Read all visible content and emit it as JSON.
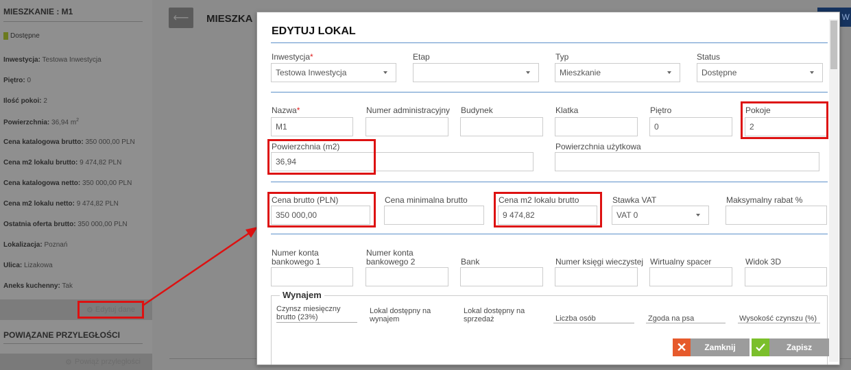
{
  "sidebar": {
    "title": "MIESZKANIE : M1",
    "status": "Dostępne",
    "rows": [
      {
        "label": "Inwestycja:",
        "value": "Testowa Inwestycja"
      },
      {
        "label": "Piętro:",
        "value": "0"
      },
      {
        "label": "Ilość pokoi:",
        "value": "2"
      },
      {
        "label": "Powierzchnia:",
        "value": "36,94 m",
        "sup": "2"
      },
      {
        "label": "Cena katalogowa brutto:",
        "value": "350 000,00 PLN"
      },
      {
        "label": "Cena m2 lokalu brutto:",
        "value": "9 474,82 PLN"
      },
      {
        "label": "Cena katalogowa netto:",
        "value": "350 000,00 PLN"
      },
      {
        "label": "Cena m2 lokalu netto:",
        "value": "9 474,82 PLN"
      },
      {
        "label": "Ostatnia oferta brutto:",
        "value": "350 000,00 PLN"
      },
      {
        "label": "Lokalizacja:",
        "value": "Poznań"
      },
      {
        "label": "Ulica:",
        "value": "Lizakowa"
      },
      {
        "label": "Aneks kuchenny:",
        "value": "Tak"
      }
    ],
    "edit_button": "Edytuj dane",
    "related_title": "POWIĄZANE PRZYLEGŁOŚCI",
    "related_button": "Powiąż przyległości"
  },
  "main": {
    "title": "MIESZKA",
    "top_button": "W"
  },
  "modal": {
    "title": "EDYTUJ LOKAL",
    "inwestycja": {
      "label": "Inwestycja",
      "value": "Testowa Inwestycja"
    },
    "etap": {
      "label": "Etap",
      "value": ""
    },
    "typ": {
      "label": "Typ",
      "value": "Mieszkanie"
    },
    "status": {
      "label": "Status",
      "value": "Dostępne"
    },
    "nazwa": {
      "label": "Nazwa",
      "value": "M1"
    },
    "numer_adm": {
      "label": "Numer administracyjny",
      "value": ""
    },
    "budynek": {
      "label": "Budynek",
      "value": ""
    },
    "klatka": {
      "label": "Klatka",
      "value": ""
    },
    "pietro": {
      "label": "Piętro",
      "value": "0"
    },
    "pokoje": {
      "label": "Pokoje",
      "value": "2"
    },
    "powierzchnia": {
      "label": "Powierzchnia (m2)",
      "value": "36,94"
    },
    "pow_uzytkowa": {
      "label": "Powierzchnia użytkowa",
      "value": ""
    },
    "cena_brutto": {
      "label": "Cena brutto (PLN)",
      "value": "350 000,00"
    },
    "cena_min": {
      "label": "Cena minimalna brutto",
      "value": ""
    },
    "cena_m2": {
      "label": "Cena m2 lokalu brutto",
      "value": "9 474,82"
    },
    "stawka_vat": {
      "label": "Stawka VAT",
      "value": "VAT 0"
    },
    "max_rabat": {
      "label": "Maksymalny rabat %",
      "value": ""
    },
    "konto1": {
      "label": "Numer konta\nbankowego 1",
      "value": ""
    },
    "konto2": {
      "label": "Numer konta\nbankowego 2",
      "value": ""
    },
    "bank": {
      "label": "Bank",
      "value": ""
    },
    "ksiega": {
      "label": "Numer księgi wieczystej",
      "value": ""
    },
    "spacer": {
      "label": "Wirtualny spacer",
      "value": ""
    },
    "widok3d": {
      "label": "Widok 3D",
      "value": ""
    },
    "wynajem": {
      "legend": "Wynajem",
      "czynsz": "Czynsz miesięczny\nbrutto (23%)",
      "dost_wynajem": "Lokal dostępny na\nwynajem",
      "dost_sprzedaz": "Lokal dostępny na\nsprzedaż",
      "liczba_osob": "Liczba osób",
      "zgoda_psa": "Zgoda na psa",
      "wysokosc": "Wysokość czynszu (%)"
    },
    "close_button": "Zamknij",
    "save_button": "Zapisz"
  },
  "colors": {
    "highlight": "#dd1111",
    "accent_line": "#5b8fc9",
    "close_icon_bg": "#e65a2c",
    "save_icon_bg": "#7bbf2b",
    "status_green": "#6b7a1e"
  }
}
